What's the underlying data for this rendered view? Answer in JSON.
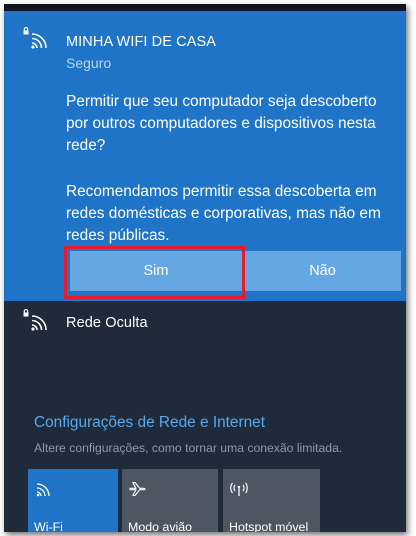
{
  "networks": [
    {
      "name": "MINHA WIFI DE CASA",
      "status": "Seguro",
      "icon": "secured-wifi-icon",
      "expanded": true,
      "prompt": "Permitir que seu computador seja descoberto por outros computadores e dispositivos nesta rede?",
      "recommendation": "Recomendamos permitir essa descoberta em redes domésticas e corporativas, mas não em redes públicas.",
      "buttons": {
        "yes": "Sim",
        "no": "Não"
      }
    },
    {
      "name": "Rede Oculta",
      "icon": "secured-wifi-icon"
    }
  ],
  "settings": {
    "title": "Configurações de Rede e Internet",
    "subtitle": "Altere configurações, como tornar uma conexão limitada."
  },
  "quick_actions": [
    {
      "label": "Wi-Fi",
      "icon": "wifi-icon",
      "active": true
    },
    {
      "label": "Modo avião",
      "icon": "airplane-icon",
      "active": false
    },
    {
      "label": "Hotspot móvel",
      "icon": "hotspot-icon",
      "active": false
    }
  ],
  "colors": {
    "accent": "#1f74c7",
    "button": "#64a7e2",
    "highlight": "#e31d2f",
    "panel": "#1f2b3a",
    "tile_inactive": "#4d5764",
    "link": "#5aa8ee"
  }
}
